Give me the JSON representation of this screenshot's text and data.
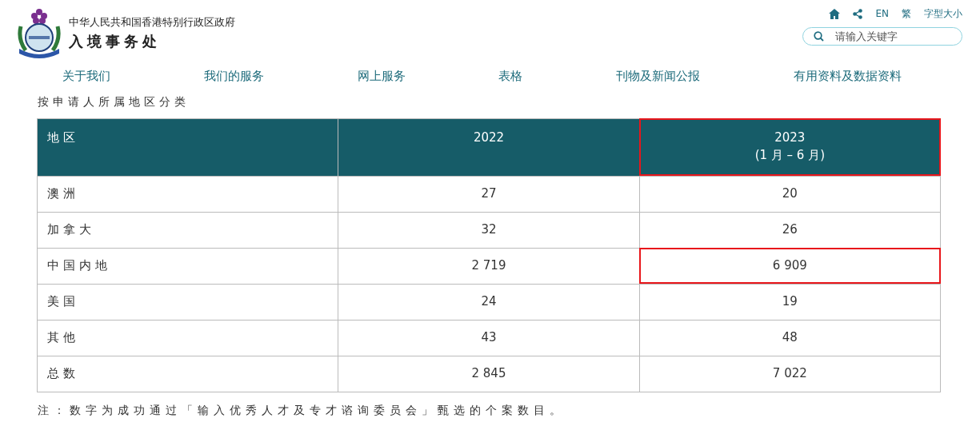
{
  "header": {
    "government": "中华人民共和国香港特别行政区政府",
    "department": "入境事务处",
    "links": [
      {
        "kind": "home"
      },
      {
        "kind": "share"
      },
      {
        "kind": "text",
        "label": "EN"
      },
      {
        "kind": "text",
        "label": "繁"
      },
      {
        "kind": "text",
        "label": "字型大小"
      }
    ],
    "search": {
      "placeholder": "请输入关键字"
    }
  },
  "nav": [
    "关于我们",
    "我们的服务",
    "网上服务",
    "表格",
    "刊物及新闻公报",
    "有用资料及数据资料"
  ],
  "subtitle": "按申请人所属地区分类",
  "table": {
    "columns": [
      {
        "lines": [
          "地区"
        ],
        "highlighted": false
      },
      {
        "lines": [
          "2022"
        ],
        "highlighted": false
      },
      {
        "lines": [
          "2023",
          "(1 月 – 6 月)"
        ],
        "highlighted": true
      }
    ],
    "rows": [
      {
        "cells": [
          {
            "text": "澳洲",
            "highlighted": false
          },
          {
            "text": "27",
            "highlighted": false
          },
          {
            "text": "20",
            "highlighted": false
          }
        ]
      },
      {
        "cells": [
          {
            "text": "加拿大",
            "highlighted": false
          },
          {
            "text": "32",
            "highlighted": false
          },
          {
            "text": "26",
            "highlighted": false
          }
        ]
      },
      {
        "cells": [
          {
            "text": "中国内地",
            "highlighted": false
          },
          {
            "text": "2 719",
            "highlighted": false
          },
          {
            "text": "6 909",
            "highlighted": true
          }
        ]
      },
      {
        "cells": [
          {
            "text": "美国",
            "highlighted": false
          },
          {
            "text": "24",
            "highlighted": false
          },
          {
            "text": "19",
            "highlighted": false
          }
        ]
      },
      {
        "cells": [
          {
            "text": "其他",
            "highlighted": false
          },
          {
            "text": "43",
            "highlighted": false
          },
          {
            "text": "48",
            "highlighted": false
          }
        ]
      },
      {
        "cells": [
          {
            "text": "总数",
            "highlighted": false
          },
          {
            "text": "2 845",
            "highlighted": false
          },
          {
            "text": "7 022",
            "highlighted": false
          }
        ]
      }
    ]
  },
  "note": "注：数字为成功通过「输入优秀人才及专才谘询委员会」甄选的个案数目。"
}
